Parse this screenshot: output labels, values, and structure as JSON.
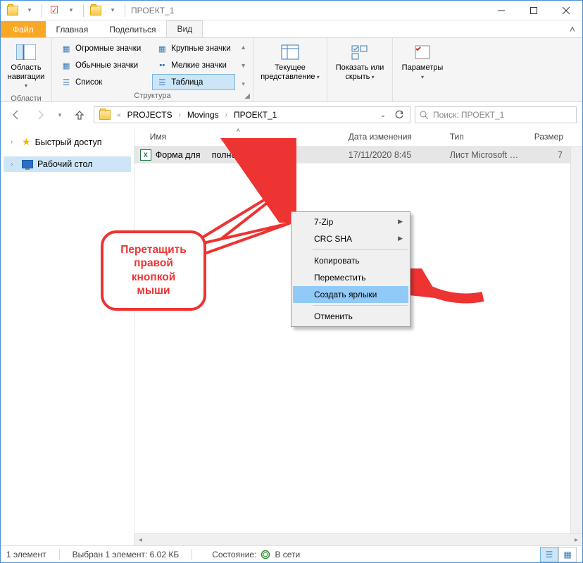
{
  "window": {
    "title": "ПРОЕКТ_1"
  },
  "tabs": {
    "file": "Файл",
    "home": "Главная",
    "share": "Поделиться",
    "view": "Вид"
  },
  "ribbon": {
    "nav_pane": "Область навигации",
    "group_panes": "Области",
    "layouts": {
      "huge": "Огромные значки",
      "large": "Крупные значки",
      "medium": "Обычные значки",
      "small": "Мелкие значки",
      "list": "Список",
      "details": "Таблица"
    },
    "group_layout": "Структура",
    "current_view": "Текущее представление",
    "show_hide": "Показать или скрыть",
    "options": "Параметры"
  },
  "breadcrumbs": {
    "b1": "PROJECTS",
    "b2": "Movings",
    "b3": "ПРОЕКТ_1"
  },
  "search": {
    "placeholder": "Поиск: ПРОЕКТ_1"
  },
  "nav": {
    "quick": "Быстрый доступ",
    "desktop": "Рабочий стол"
  },
  "columns": {
    "name": "Имя",
    "date": "Дата изменения",
    "type": "Тип",
    "size": "Размер"
  },
  "file": {
    "name": "Форма для заполнения.xlsx",
    "name_vis_prefix": "Форма для ",
    "name_vis_suffix": "полнения.xlsx",
    "date": "17/11/2020 8:45",
    "type": "Лист Microsoft Ex…",
    "size_kb": "7"
  },
  "context_menu": {
    "sevenzip": "7-Zip",
    "crc": "CRC SHA",
    "copy": "Копировать",
    "move": "Переместить",
    "shortcut": "Создать ярлыки",
    "cancel": "Отменить"
  },
  "callout": {
    "l1": "Перетащить",
    "l2": "правой",
    "l3": "кнопкой",
    "l4": "мыши"
  },
  "status": {
    "items": "1 элемент",
    "selected": "Выбран 1 элемент: 6.02 КБ",
    "state_label": "Состояние:",
    "network": "В сети"
  }
}
